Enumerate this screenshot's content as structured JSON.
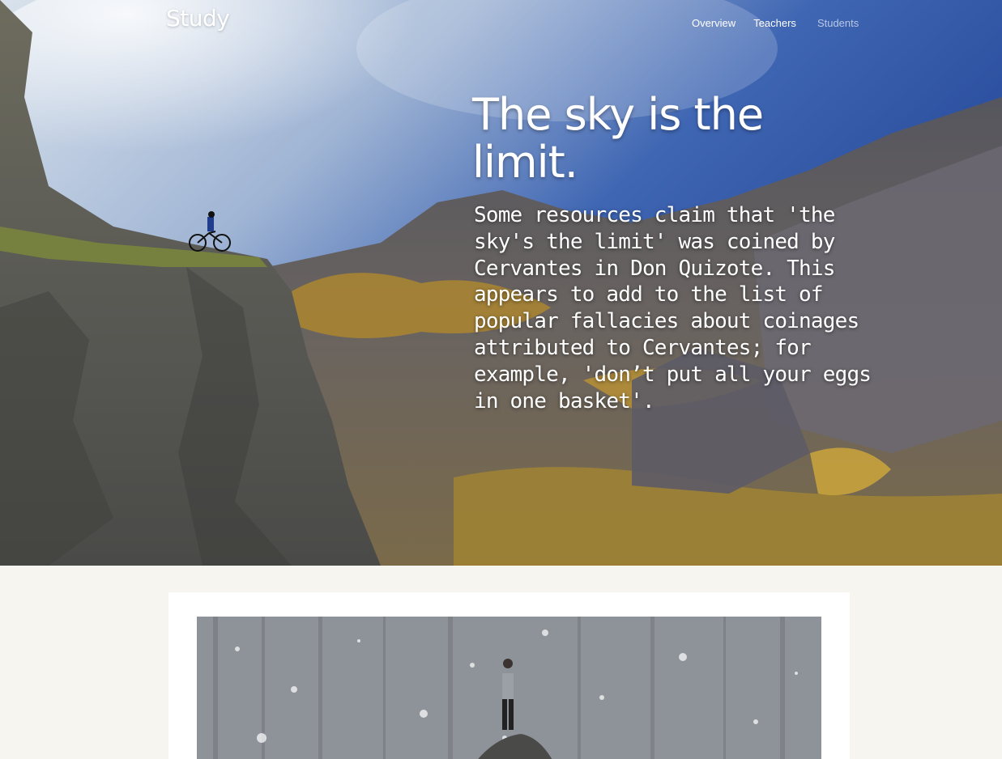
{
  "header": {
    "brand": "Study",
    "nav": [
      {
        "label": "Overview"
      },
      {
        "label": "Teachers"
      },
      {
        "label": "Students"
      }
    ]
  },
  "hero": {
    "headline": "The sky is the limit.",
    "paragraph": "Some resources claim that 'the sky's the limit' was coined by Cervantes in Don Quizote. This appears to add to the list of popular fallacies about coinages attributed to Cervantes; for example, 'don’t put all your eggs in one basket'."
  },
  "colors": {
    "page_background": "#f6f5ef",
    "card_background": "#ffffff",
    "nav_active": "#ffffff",
    "nav_muted": "#b9c8e6"
  }
}
